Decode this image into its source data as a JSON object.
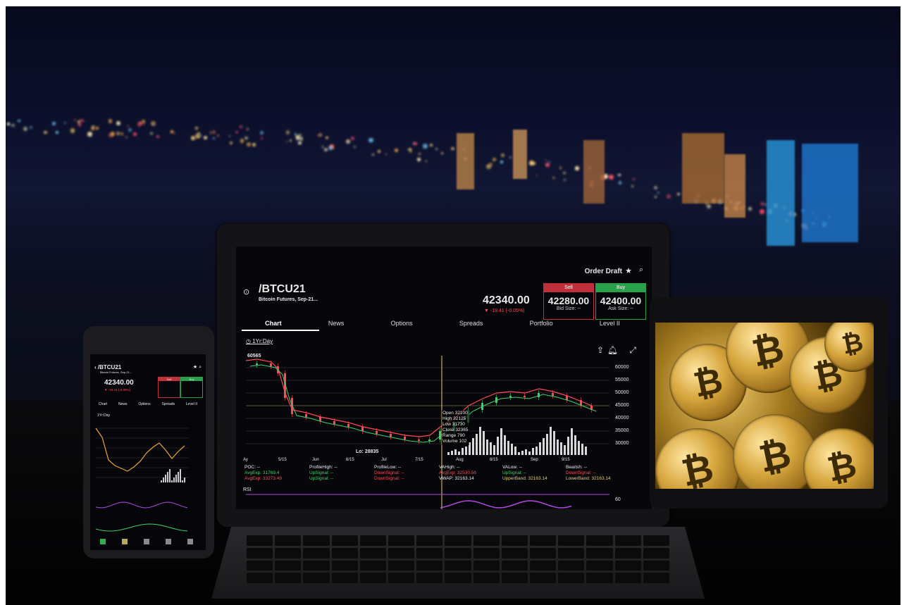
{
  "laptop": {
    "order_draft": "Order Draft",
    "symbol": "/BTCU21",
    "contract": "Bitcoin Futures, Sep-21...",
    "last_price": "42340.00",
    "change": "▼ -19.41 (-0.05%)",
    "sell_label": "Sell",
    "sell_price": "42280.00",
    "bid_size": "Bid Size: --",
    "buy_label": "Buy",
    "buy_price": "42400.00",
    "ask_size": "Ask Size: --",
    "tabs": [
      "Chart",
      "News",
      "Options",
      "Spreads",
      "Portfolio",
      "Level II"
    ],
    "range": "1Yr:Day",
    "chart_high": "60565",
    "chart_low": "Lo: 28835",
    "y_ticks": [
      "60000",
      "55000",
      "50000",
      "45000",
      "40000",
      "35000",
      "30000"
    ],
    "x_ticks": [
      "Ay",
      "5/15",
      "Jun",
      "6/15",
      "Jul",
      "7/15",
      "Aug",
      "8/15",
      "Sep",
      "9/15"
    ],
    "tooltip": [
      "Open   32100",
      "High   32125",
      "Low    31730",
      "Close  32365",
      "Range  790",
      "Volume 102"
    ],
    "poc": "POC: --",
    "avg_exp_1": "AvgExp: 31769.4",
    "avg_exp_2": "AvgExp: 33273.49",
    "profile_high": "ProfileHigh: --",
    "upsignal_1": "UpSignal: --",
    "upsignal_2": "UpSignal: --",
    "profile_low": "ProfileLow: --",
    "downsignal_1": "DownSignal: --",
    "downsignal_2": "DownSignal: --",
    "vahigh": "VAHigh: --",
    "avg_exp_3": "AvgExp: 32530.56",
    "vwap": "VWAP: 32163.14",
    "valow": "VALow: --",
    "upsignal_3": "UpSignal: --",
    "upper_band": "UpperBand: 32163.14",
    "bearish": "Bearish: --",
    "downsignal_3": "DownSignal: --",
    "lower_band": "LowerBand: 32163.14",
    "rsi_label": "RSI",
    "rsi_tick": "60"
  },
  "phone": {
    "symbol": "/BTCU21",
    "contract": "Bitcoin Futures, Sep-21...",
    "last_price": "42340.00",
    "change": "▼ -19.41 (-0.05%)",
    "sell_label": "Sell",
    "buy_label": "Buy",
    "tabs": [
      "Chart",
      "News",
      "Options",
      "Spreads",
      "Level II"
    ],
    "range": "1Yr:Day"
  },
  "colors": {
    "sell": "#c0303a",
    "buy": "#2aa04a",
    "candle_up": "#3dd36a",
    "candle_down": "#ff4a55",
    "avg_red": "#ff4a55",
    "avg_green": "#3dd36a",
    "rsi": "#b24adf",
    "crosshair": "#e6d06a"
  },
  "icons": [
    "star-icon",
    "search-icon",
    "share-icon",
    "bell-icon",
    "expand-icon",
    "back-icon",
    "bitcoin-logo"
  ]
}
